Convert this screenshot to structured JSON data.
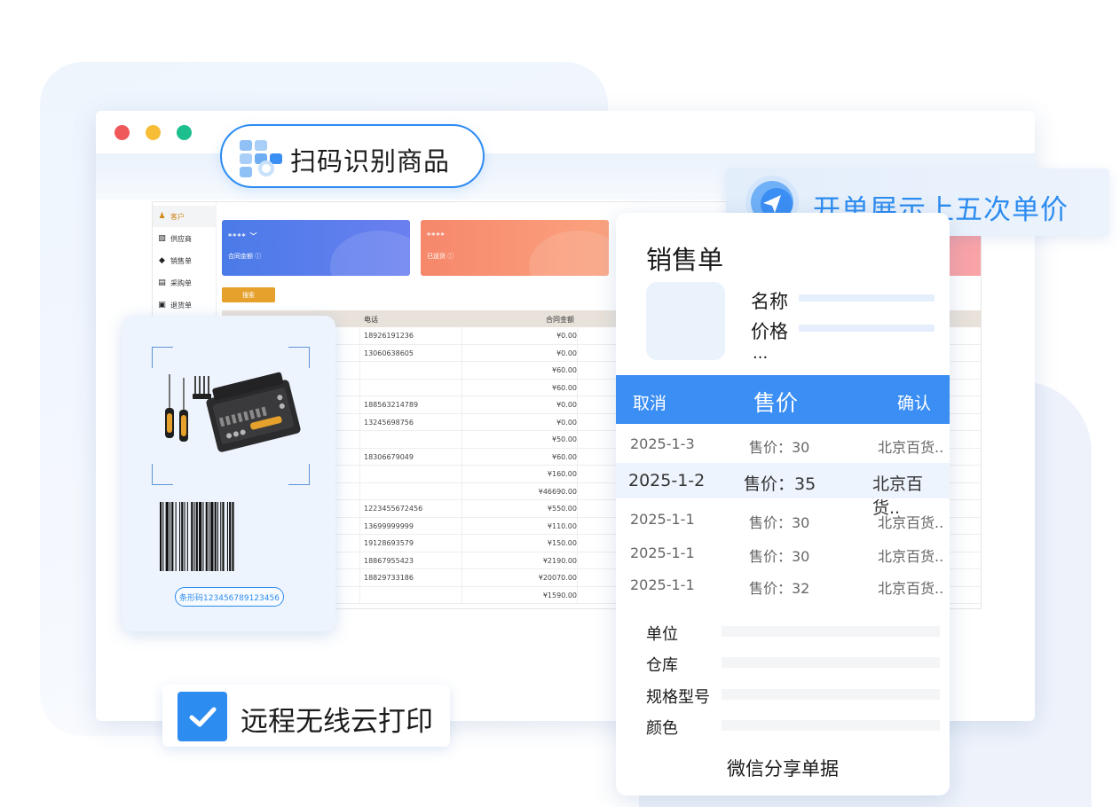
{
  "badges": {
    "scan_label": "扫码识别商品",
    "price_label": "开单展示上五次单价",
    "print_label": "远程无线云打印"
  },
  "app": {
    "sidebar": [
      {
        "label": "客户",
        "icon": "user-group-icon",
        "active": true
      },
      {
        "label": "供应商",
        "icon": "supplier-icon",
        "active": false
      },
      {
        "label": "销售单",
        "icon": "tag-icon",
        "active": false
      },
      {
        "label": "采购单",
        "icon": "cart-icon",
        "active": false
      },
      {
        "label": "退货单",
        "icon": "return-icon",
        "active": false
      }
    ],
    "cards": [
      {
        "value": "**** ﹀",
        "label": "合同金额 ⓘ",
        "color": "#4a7be8"
      },
      {
        "value": "****",
        "label": "已送货 ⓘ",
        "color": "#f6876b"
      }
    ],
    "search_button": "搜索",
    "columns": {
      "phone": "电话",
      "amount": "合同金额"
    },
    "rows": [
      {
        "phone": "18926191236",
        "amount": "¥0.00"
      },
      {
        "phone": "13060638605",
        "amount": "¥0.00"
      },
      {
        "phone": "",
        "amount": "¥60.00"
      },
      {
        "phone": "",
        "amount": "¥60.00"
      },
      {
        "phone": "188563214789",
        "amount": "¥0.00"
      },
      {
        "phone": "13245698756",
        "amount": "¥0.00"
      },
      {
        "phone": "",
        "amount": "¥50.00"
      },
      {
        "phone": "18306679049",
        "amount": "¥60.00"
      },
      {
        "phone": "",
        "amount": "¥160.00"
      },
      {
        "phone": "",
        "amount": "¥46690.00"
      },
      {
        "phone": "1223455672456",
        "amount": "¥550.00"
      },
      {
        "phone": "13699999999",
        "amount": "¥110.00"
      },
      {
        "phone": "19128693579",
        "amount": "¥150.00"
      },
      {
        "phone": "18867955423",
        "amount": "¥2190.00"
      },
      {
        "phone": "18829733186",
        "amount": "¥20070.00"
      },
      {
        "phone": "",
        "amount": "¥1590.00"
      }
    ]
  },
  "barcode_card": {
    "product_icon": "screwdriver-toolkit-icon",
    "barcode_text": "条形码123456789123456"
  },
  "sales_order": {
    "title": "销售单",
    "fields": [
      {
        "label": "名称"
      },
      {
        "label": "价格"
      }
    ],
    "ellipsis": "...",
    "picker": {
      "cancel": "取消",
      "title": "售价",
      "confirm": "确认",
      "rows": [
        {
          "date": "2025-1-3",
          "price": "售价：30",
          "store": "北京百货..",
          "selected": false
        },
        {
          "date": "2025-1-2",
          "price": "售价：35",
          "store": "北京百货..",
          "selected": true
        },
        {
          "date": "2025-1-1",
          "price": "售价：30",
          "store": "北京百货..",
          "selected": false
        },
        {
          "date": "2025-1-1",
          "price": "售价：30",
          "store": "北京百货..",
          "selected": false
        },
        {
          "date": "2025-1-1",
          "price": "售价：32",
          "store": "北京百货..",
          "selected": false
        }
      ]
    },
    "attributes": [
      {
        "label": "单位"
      },
      {
        "label": "仓库"
      },
      {
        "label": "规格型号"
      },
      {
        "label": "颜色"
      }
    ],
    "share_label": "微信分享单据"
  },
  "colors": {
    "accent": "#2d8cf0",
    "picker_header": "#3b8ef3",
    "sidebar_active": "#d08a1f",
    "search_button": "#e5a12c"
  }
}
